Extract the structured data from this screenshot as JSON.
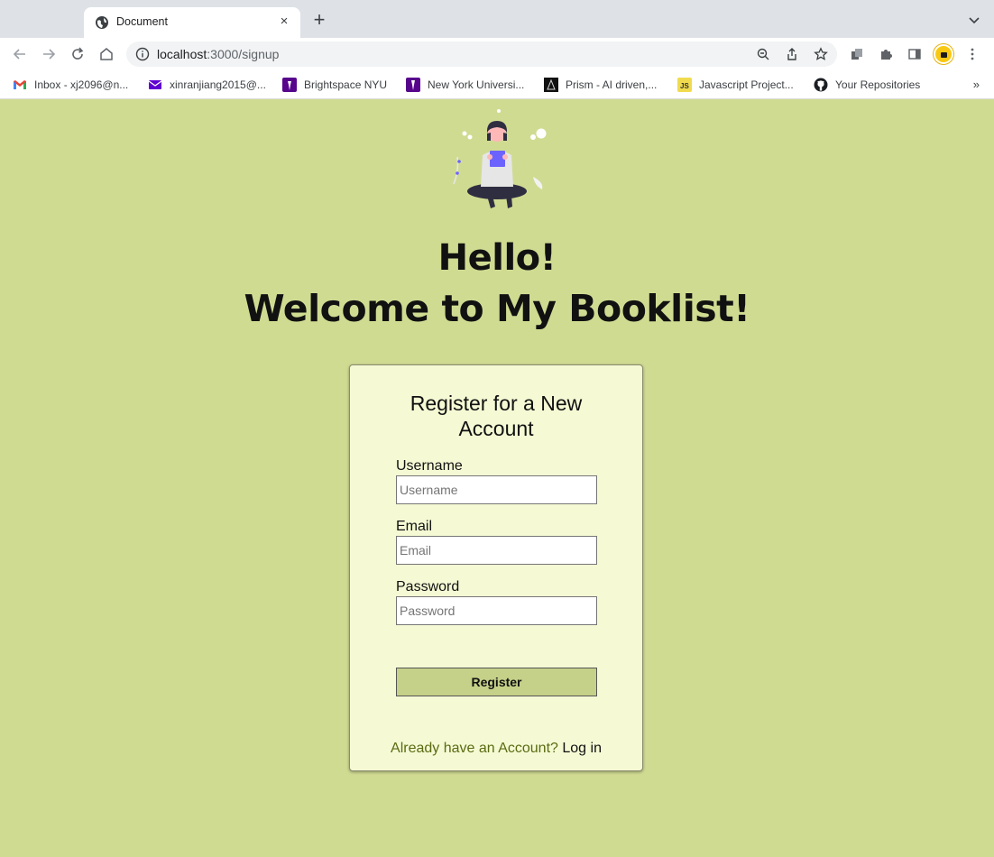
{
  "browser": {
    "tab": {
      "title": "Document",
      "favicon": "globe-icon",
      "close": "×"
    },
    "new_tab": "+",
    "url": {
      "host": "localhost",
      "path": ":3000/signup"
    },
    "bookmarks": [
      {
        "label": "Inbox - xj2096@n...",
        "icon": "gmail-icon"
      },
      {
        "label": "xinranjiang2015@...",
        "icon": "mail-icon"
      },
      {
        "label": "Brightspace NYU",
        "icon": "nyu-torch-icon"
      },
      {
        "label": "New York Universi...",
        "icon": "nyu-torch-icon"
      },
      {
        "label": "Prism - AI driven,...",
        "icon": "prism-icon"
      },
      {
        "label": "Javascript Project...",
        "icon": "js-icon"
      },
      {
        "label": "Your Repositories",
        "icon": "github-icon"
      }
    ],
    "bookmarks_more": "»",
    "colors": {
      "tabstrip": "#dee1e6",
      "omnibox": "#f1f3f4",
      "profile": "#f9c912"
    }
  },
  "page": {
    "heading_line1": "Hello!",
    "heading_line2": "Welcome to My Booklist!",
    "form": {
      "title": "Register for a New Account",
      "username_label": "Username",
      "username_placeholder": "Username",
      "email_label": "Email",
      "email_placeholder": "Email",
      "password_label": "Password",
      "password_placeholder": "Password",
      "submit_label": "Register",
      "login_prompt": "Already have an Account?",
      "login_link": "Log in"
    },
    "colors": {
      "background": "#d0db92",
      "card": "#f5fad4",
      "button": "#c5d088",
      "prompt": "#5a6b12"
    }
  }
}
